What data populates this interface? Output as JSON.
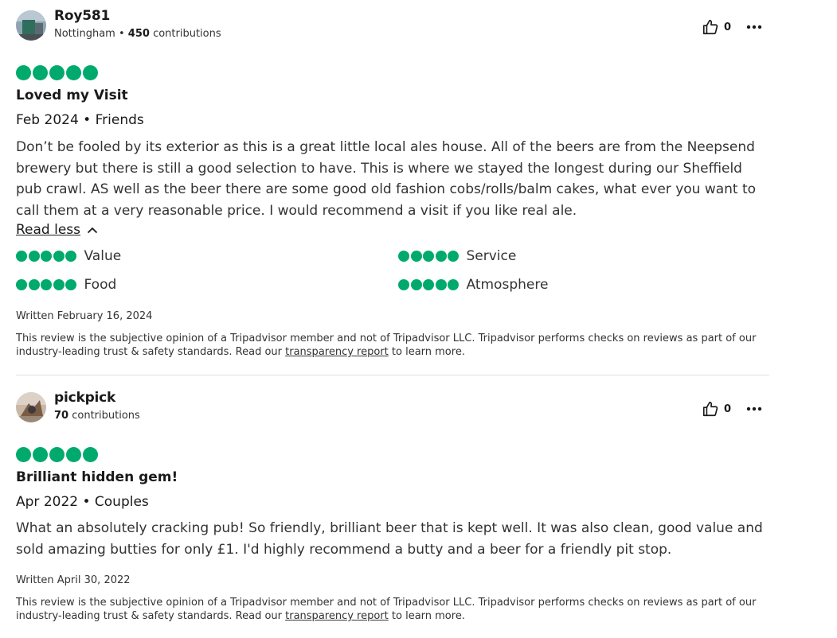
{
  "reviews": [
    {
      "username": "Roy581",
      "location": "Nottingham",
      "separator": " • ",
      "contributions_count": "450",
      "contributions_label": " contributions",
      "likes": "0",
      "rating": 5,
      "title": "Loved my Visit",
      "date_line": "Feb 2024 • Friends",
      "body": "Don’t be fooled by its exterior as this is a great little local ales house. All of the beers are from the Neepsend brewery but there is still a good selection to have. This is where we stayed the longest during our Sheffield pub crawl. AS well as the beer there are some good old fashion cobs/rolls/balm cakes, what ever you want to call them at a very reasonable price. I would recommend a visit if you like real ale.",
      "read_less": "Read less",
      "sub_ratings": [
        {
          "label": "Value",
          "rating": 5
        },
        {
          "label": "Service",
          "rating": 5
        },
        {
          "label": "Food",
          "rating": 5
        },
        {
          "label": "Atmosphere",
          "rating": 5
        }
      ],
      "written": "Written February 16, 2024",
      "disclaimer_pre": "This review is the subjective opinion of a Tripadvisor member and not of Tripadvisor LLC. Tripadvisor performs checks on reviews as part of our industry-leading trust & safety standards. Read our ",
      "disclaimer_link": "transparency report",
      "disclaimer_post": " to learn more."
    },
    {
      "username": "pickpick",
      "contributions_count": "70",
      "contributions_label": " contributions",
      "likes": "0",
      "rating": 5,
      "title": "Brilliant hidden gem!",
      "date_line": "Apr 2022 • Couples",
      "body": "What an absolutely cracking pub! So friendly, brilliant beer that is kept well. It was also clean, good value and sold amazing butties for only £1. I'd highly recommend a butty and a beer for a friendly pit stop.",
      "written": "Written April 30, 2022",
      "disclaimer_pre": "This review is the subjective opinion of a Tripadvisor member and not of Tripadvisor LLC. Tripadvisor performs checks on reviews as part of our industry-leading trust & safety standards. Read our ",
      "disclaimer_link": "transparency report",
      "disclaimer_post": " to learn more."
    }
  ],
  "colors": {
    "bubble": "#00aa6c",
    "divider": "#e0e0e0"
  },
  "icons": {
    "like": "thumbs-up-icon",
    "more": "more-horizontal-icon",
    "chevron": "chevron-up-icon"
  }
}
